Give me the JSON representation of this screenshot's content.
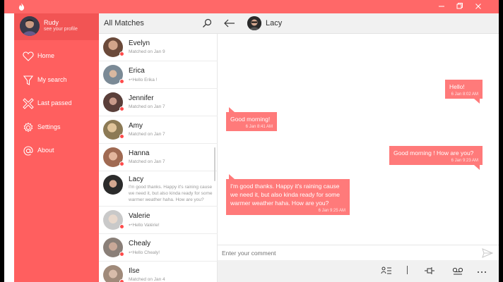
{
  "window": {
    "title_bar_color": "#ff6868",
    "icons": [
      "flame-app-icon",
      "minimize-icon",
      "maximize-icon",
      "close-icon"
    ]
  },
  "sidebar": {
    "profile": {
      "name": "Rudy",
      "subtitle": "see your profile"
    },
    "items": [
      {
        "label": "Home",
        "icon": "heart-icon"
      },
      {
        "label": "My search",
        "icon": "funnel-icon"
      },
      {
        "label": "Last passed",
        "icon": "cross-icon"
      },
      {
        "label": "Settings",
        "icon": "gear-icon"
      },
      {
        "label": "About",
        "icon": "at-sign-icon"
      }
    ]
  },
  "matches": {
    "title": "All Matches",
    "items": [
      {
        "name": "Evelyn",
        "sub": "Matched on Jan 9",
        "color": "#6b4a3a"
      },
      {
        "name": "Erica",
        "sub": "↩Hello Erika !",
        "color": "#7b8a96"
      },
      {
        "name": "Jennifer",
        "sub": "Matched on Jan 7",
        "color": "#5a3f3a"
      },
      {
        "name": "Amy",
        "sub": "Matched on Jan 7",
        "color": "#8c7a55"
      },
      {
        "name": "Hanna",
        "sub": "Matched on Jan 7",
        "color": "#a06a52"
      },
      {
        "name": "Lacy",
        "sub": "I'm good thanks. Happy it's raining cause\nwe need it, but also kinda ready for some\nwarmer weather haha. How are you?",
        "color": "#3a3a3a"
      },
      {
        "name": "Valerie",
        "sub": "↩Hello Valérie!",
        "color": "#c9c9c9"
      },
      {
        "name": "Chealy",
        "sub": "↩Hello Chealy!",
        "color": "#8a7f78"
      },
      {
        "name": "Ilse",
        "sub": "Matched on Jan 4",
        "color": "#a08a7a"
      }
    ]
  },
  "chat": {
    "contact": "Lacy",
    "messages": [
      {
        "text": "Hello!",
        "time": "6 Jan 8:02 AM",
        "side": "right"
      },
      {
        "text": "Good morning!",
        "time": "6 Jan 8:41 AM",
        "side": "left"
      },
      {
        "text": "Good morning ! How are you?",
        "time": "6 Jan 9:23 AM",
        "side": "right"
      },
      {
        "text": "I'm good thanks. Happy it's raining cause we need it, but also kinda ready for some warmer weather haha. How are you?",
        "time": "6 Jan 9:25 AM",
        "side": "left"
      }
    ],
    "composer_placeholder": "Enter your comment",
    "bottom_icons": [
      "list-icon",
      "pin-icon",
      "voicemail-icon",
      "more-icon"
    ]
  }
}
